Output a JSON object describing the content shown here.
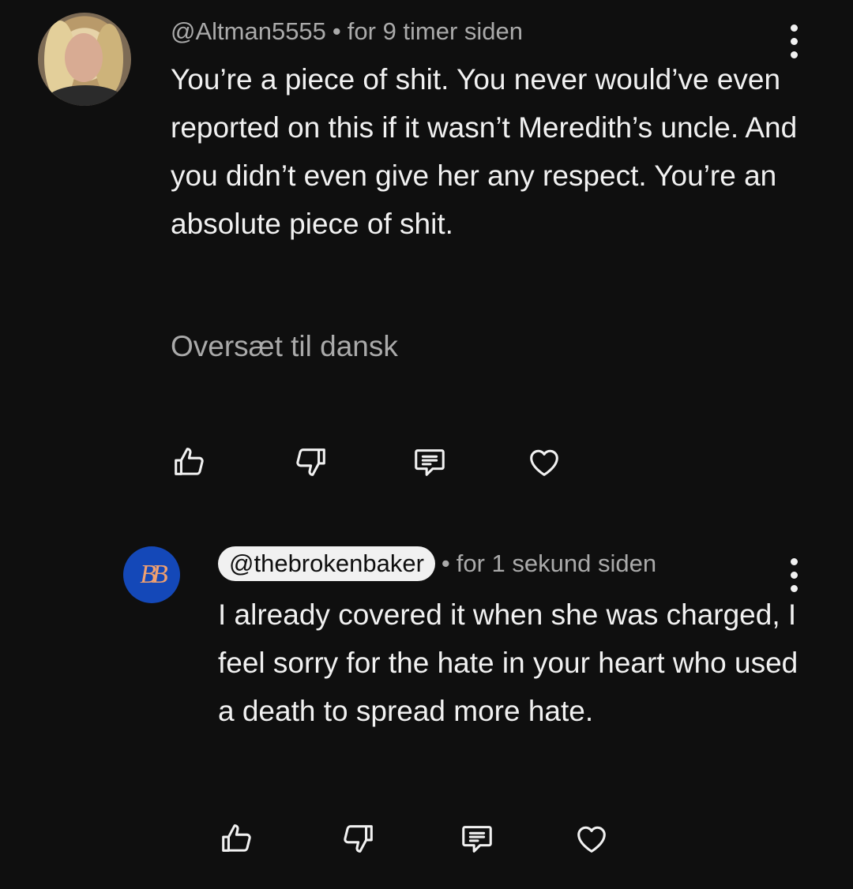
{
  "comments": [
    {
      "handle": "@Altman5555",
      "time": "for 9 timer siden",
      "text": "You’re a piece of shit. You never would’ve even reported on this if it wasn’t Meredith’s uncle. And you didn’t even give her any respect. You’re an absolute piece of shit.",
      "translate": "Oversæt til dansk"
    },
    {
      "handle": "@thebrokenbaker",
      "avatar_initials": "BB",
      "time": "for 1 sekund siden",
      "text": "I already covered it when she was charged, I feel sorry for the hate in your heart who used a death to spread more hate."
    }
  ],
  "icons": {
    "like": "thumbs-up-icon",
    "dislike": "thumbs-down-icon",
    "reply": "reply-icon",
    "heart": "heart-icon",
    "menu": "more-vertical-icon"
  },
  "colors": {
    "background": "#0f0f0f",
    "text": "#f1f1f1",
    "secondary": "#aaaaaa",
    "avatar_bb": "#1448b8"
  }
}
